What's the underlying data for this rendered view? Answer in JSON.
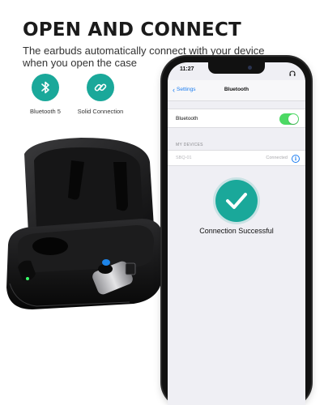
{
  "header": {
    "title": "OPEN AND CONNECT",
    "subtitle": "The earbuds automatically connect with your device when you open the case"
  },
  "features": [
    {
      "icon": "bluetooth-icon",
      "label": "Bluetooth 5"
    },
    {
      "icon": "link-icon",
      "label": "Solid Connection"
    }
  ],
  "phone": {
    "status_time": "11:27",
    "nav": {
      "back_label": "Settings",
      "title": "Bluetooth"
    },
    "bluetooth_row": {
      "label": "Bluetooth",
      "enabled": true
    },
    "section_header": "MY DEVICES",
    "device": {
      "name": "SBQ-01",
      "status": "Connected"
    },
    "success_message": "Connection Successful"
  },
  "colors": {
    "accent": "#1aa89a",
    "ios_blue": "#1a7cf0",
    "toggle_on": "#4cd964"
  }
}
